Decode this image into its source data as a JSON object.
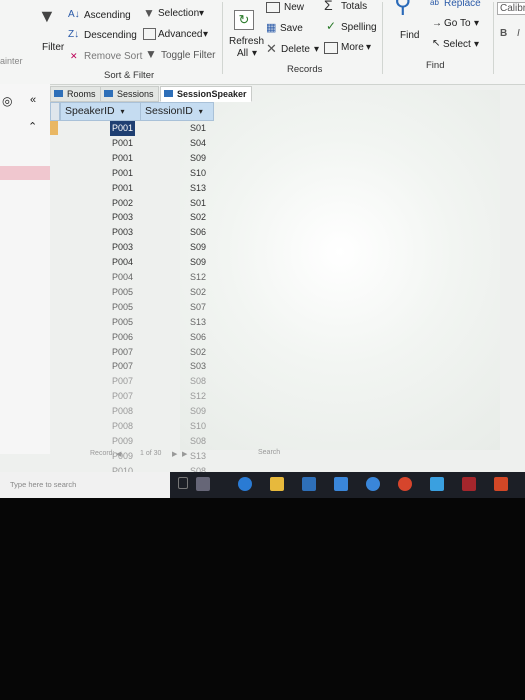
{
  "ribbon": {
    "sort_filter": {
      "filter": "Filter",
      "ascending": "Ascending",
      "descending": "Descending",
      "remove_sort": "Remove Sort",
      "selection": "Selection",
      "advanced": "Advanced",
      "toggle_filter": "Toggle Filter",
      "group_label": "Sort & Filter"
    },
    "records": {
      "refresh": "Refresh",
      "refresh_all": "All",
      "new": "New",
      "save": "Save",
      "delete": "Delete",
      "totals": "Totals",
      "spelling": "Spelling",
      "more": "More",
      "group_label": "Records"
    },
    "find": {
      "find": "Find",
      "replace": "Replace",
      "goto": "Go To",
      "select": "Select",
      "group_label": "Find"
    },
    "font": {
      "name": "Calibr",
      "bold": "B",
      "italic": "I"
    },
    "left_cut": "ainter"
  },
  "tabs": [
    {
      "label": "Rooms"
    },
    {
      "label": "Sessions"
    },
    {
      "label": "SessionSpeaker"
    }
  ],
  "columns": {
    "speaker": "SpeakerID",
    "session": "SessionID"
  },
  "rows": [
    {
      "speaker": "P001",
      "session": "S01"
    },
    {
      "speaker": "P001",
      "session": "S04"
    },
    {
      "speaker": "P001",
      "session": "S09"
    },
    {
      "speaker": "P001",
      "session": "S10"
    },
    {
      "speaker": "P001",
      "session": "S13"
    },
    {
      "speaker": "P002",
      "session": "S01"
    },
    {
      "speaker": "P003",
      "session": "S02"
    },
    {
      "speaker": "P003",
      "session": "S06"
    },
    {
      "speaker": "P003",
      "session": "S09"
    },
    {
      "speaker": "P004",
      "session": "S09"
    },
    {
      "speaker": "P004",
      "session": "S12"
    },
    {
      "speaker": "P005",
      "session": "S02"
    },
    {
      "speaker": "P005",
      "session": "S07"
    },
    {
      "speaker": "P005",
      "session": "S13"
    },
    {
      "speaker": "P006",
      "session": "S06"
    },
    {
      "speaker": "P007",
      "session": "S02"
    },
    {
      "speaker": "P007",
      "session": "S03"
    },
    {
      "speaker": "P007",
      "session": "S08"
    },
    {
      "speaker": "P007",
      "session": "S12"
    },
    {
      "speaker": "P008",
      "session": "S09"
    },
    {
      "speaker": "P008",
      "session": "S10"
    },
    {
      "speaker": "P009",
      "session": "S08"
    },
    {
      "speaker": "P009",
      "session": "S13"
    },
    {
      "speaker": "P010",
      "session": "S08"
    }
  ],
  "navigation": {
    "record_label": "Record:",
    "position": "1 of 30",
    "search": "Search"
  },
  "taskbar": {
    "search_placeholder": "Type here to search"
  }
}
